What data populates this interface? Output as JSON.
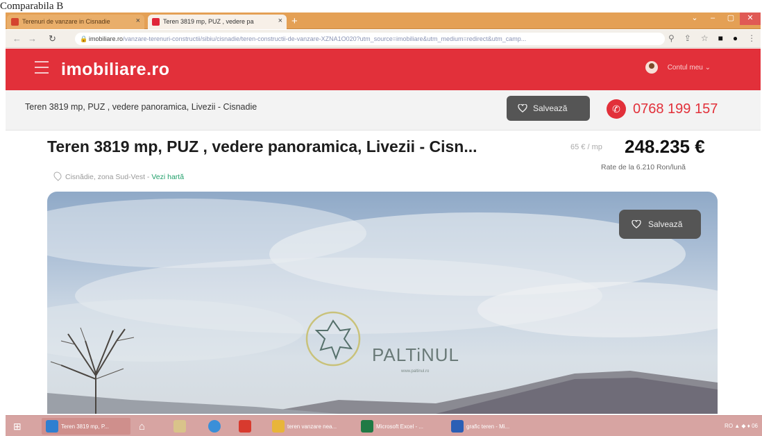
{
  "caption": "Comparabila B",
  "browser": {
    "tabs": [
      {
        "label": "Terenuri de vanzare in Cisnadie"
      },
      {
        "label": "Teren 3819 mp, PUZ , vedere pa"
      }
    ],
    "new_tab": "+",
    "window_controls": [
      "⌄",
      "–",
      "▢",
      "✕"
    ],
    "url_host": "imobiliare.ro",
    "url_path": "/vanzare-terenuri-constructii/sibiu/cisnadie/teren-constructii-de-vanzare-XZNA1O020?utm_source=imobiliare&utm_medium=redirect&utm_camp..."
  },
  "header": {
    "logo": "imobiliare.ro",
    "account": "Contul meu ⌄"
  },
  "sticky": {
    "title": "Teren 3819 mp, PUZ , vedere panoramica, Livezii - Cisnadie",
    "save_label": "Salvează",
    "phone": "0768 199 157"
  },
  "listing": {
    "title": "Teren 3819 mp, PUZ , vedere panoramica, Livezii - Cisn...",
    "price_per": "65 € / mp",
    "price": "248.235 €",
    "rates": "Rate de la 6.210 Ron/lună",
    "location": "Cisnădie, zona Sud-Vest",
    "map_link": "Vezi hartă",
    "image_save_label": "Salvează",
    "brand": "PALTiNUL",
    "brand_sub": "www.paltinul.ro"
  },
  "taskbar": {
    "items": [
      {
        "label": "Teren 3819 mp, P...",
        "color": "#2f7fd0"
      },
      {
        "label": "teren vanzare nea...",
        "color": "#e8b53a"
      },
      {
        "label": "Microsoft Excel - ...",
        "color": "#1f7a45"
      },
      {
        "label": "grafic teren - Mi...",
        "color": "#2b5fb5"
      }
    ],
    "tray": "RO ▲ ◆ ♦ 06"
  },
  "colors": {
    "brand_red": "#e2303a",
    "tab_bar": "#e4a055",
    "taskbar": "#d7a4a2",
    "map_link": "#22a06b"
  }
}
